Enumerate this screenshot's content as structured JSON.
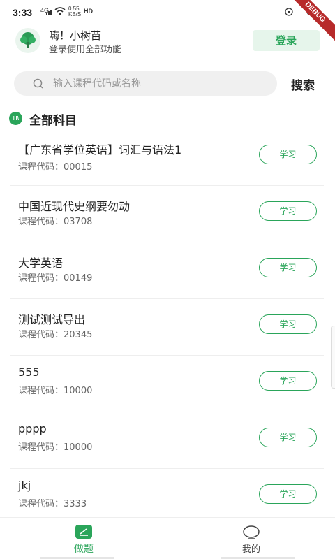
{
  "status_bar": {
    "time": "3:33",
    "signal": "4G",
    "net_speed_value": "0.55",
    "net_speed_unit": "KB/S",
    "hd": "HD",
    "debug_banner": "DEBUG"
  },
  "header": {
    "greeting": "嗨！小树苗",
    "subtitle": "登录使用全部功能",
    "login_label": "登录"
  },
  "search": {
    "placeholder": "输入课程代码或名称",
    "value": "",
    "button_label": "搜索"
  },
  "section": {
    "icon_text": "III\\",
    "title": "全部科目"
  },
  "course_code_prefix": "课程代码：",
  "courses": [
    {
      "title": "【广东省学位英语】词汇与语法1",
      "code_label": "课程代码：00015",
      "action": "学习"
    },
    {
      "title": "中国近现代史纲要勿动",
      "code_label": "课程代码：03708",
      "action": "学习"
    },
    {
      "title": "大学英语",
      "code_label": "课程代码：00149",
      "action": "学习"
    },
    {
      "title": "测试测试导出",
      "code_label": "课程代码：20345",
      "action": "学习"
    },
    {
      "title": "555",
      "code_label": "课程代码：10000",
      "action": "学习"
    },
    {
      "title": "pppp",
      "code_label": "课程代码：10000",
      "action": "学习"
    },
    {
      "title": "jkj",
      "code_label": "课程代码：3333",
      "action": "学习"
    }
  ],
  "bottom_nav": {
    "items": [
      {
        "label": "做题",
        "icon": "edit-icon",
        "active": true
      },
      {
        "label": "我的",
        "icon": "chat-bubble-icon",
        "active": false
      }
    ]
  },
  "colors": {
    "accent": "#2aa55a",
    "accent_light": "#e6f5eb",
    "debug": "#b72a2a"
  }
}
